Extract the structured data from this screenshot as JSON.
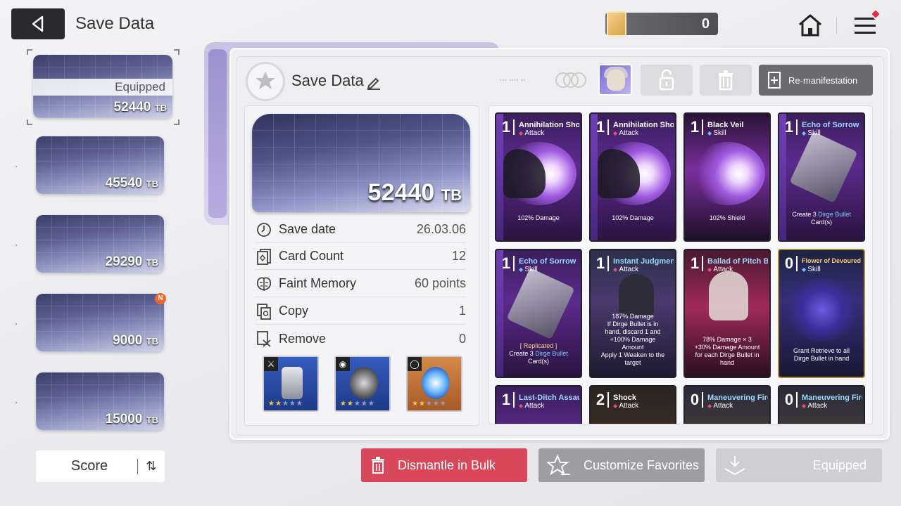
{
  "header": {
    "title": "Save Data",
    "currency_value": "0"
  },
  "slots": [
    {
      "value": "52440",
      "unit": "TB",
      "equipped_label": "Equipped",
      "selected": true
    },
    {
      "value": "45540",
      "unit": "TB"
    },
    {
      "value": "29290",
      "unit": "TB"
    },
    {
      "value": "9000",
      "unit": "TB",
      "badge": "N"
    },
    {
      "value": "15000",
      "unit": "TB"
    }
  ],
  "score_button": {
    "label": "Score"
  },
  "panel": {
    "title": "Save Data",
    "remanifest_label": "Re-manifestation",
    "hero_value": "52440",
    "hero_unit": "TB",
    "info": [
      {
        "label": "Save date",
        "value": "26.03.06",
        "icon": "clock-icon"
      },
      {
        "label": "Card Count",
        "value": "12",
        "icon": "cards-icon"
      },
      {
        "label": "Faint Memory",
        "value": "60 points",
        "icon": "brain-icon"
      },
      {
        "label": "Copy",
        "value": "1",
        "icon": "copy-icon"
      },
      {
        "label": "Remove",
        "value": "0",
        "icon": "remove-icon"
      }
    ],
    "equipment": [
      {
        "type": "sword-icon",
        "color": "#2f4fa8"
      },
      {
        "type": "armor-icon",
        "color": "#2f4fa8"
      },
      {
        "type": "ring-icon",
        "color": "#c9783f"
      }
    ]
  },
  "cards": [
    {
      "cost": "1",
      "name": "Annihilation Shot",
      "type": "Attack",
      "desc": "102% Damage"
    },
    {
      "cost": "1",
      "name": "Annihilation Shot",
      "type": "Attack",
      "desc": "102% Damage"
    },
    {
      "cost": "1",
      "name": "Black Veil",
      "type": "Skill",
      "desc": "102% Shield"
    },
    {
      "cost": "1",
      "name": "Echo of Sorrow",
      "type": "Skill",
      "desc_pre": "Create 3 ",
      "desc_kw": "Dirge Bullet",
      "desc_post": " Card(s)"
    },
    {
      "cost": "1",
      "name": "Echo of Sorrow",
      "type": "Skill",
      "tag": "[ Replicated ]",
      "desc_pre": "Create 3 ",
      "desc_kw": "Dirge Bullet",
      "desc_post": " Card(s)"
    },
    {
      "cost": "1",
      "name": "Instant Judgment",
      "type": "Attack",
      "desc_lines": [
        "187% Damage",
        "If Dirge Bullet is in",
        "hand, discard 1 and",
        "+100% Damage",
        "Amount",
        "Apply 1 Weaken to the",
        "target"
      ]
    },
    {
      "cost": "1",
      "name": "Ballad of Pitch Black",
      "type": "Attack",
      "desc_lines": [
        "78% Damage × 3",
        "+30% Damage Amount",
        "for each Dirge Bullet in",
        "hand"
      ]
    },
    {
      "cost": "0",
      "name": "Flower of Devoured Fate",
      "type": "Skill",
      "desc_lines": [
        "Grant Retrieve to all",
        "Dirge Bullet in hand"
      ]
    },
    {
      "cost": "1",
      "name": "Last-Ditch Assault",
      "type": "Attack"
    },
    {
      "cost": "2",
      "name": "Shock",
      "type": "Attack"
    },
    {
      "cost": "0",
      "name": "Maneuvering Fire",
      "type": "Attack"
    },
    {
      "cost": "0",
      "name": "Maneuvering Fire",
      "type": "Attack"
    }
  ],
  "bottom": {
    "dismantle_label": "Dismantle in Bulk",
    "favorites_label": "Customize Favorites",
    "equipped_label": "Equipped"
  },
  "colors": {
    "accent_red": "#d9475a",
    "dark": "#2a2a2e",
    "keyword_blue": "#7fd0ff"
  }
}
